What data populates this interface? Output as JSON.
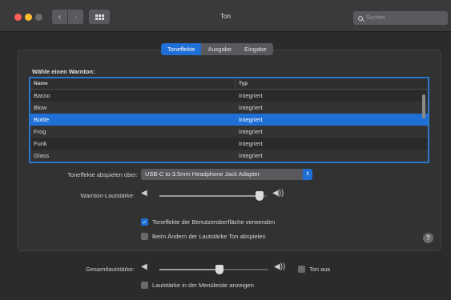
{
  "window": {
    "title": "Ton"
  },
  "toolbar": {
    "back": "‹",
    "forward": "›",
    "search_placeholder": "Suchen"
  },
  "tabs": [
    {
      "label": "Toneffekte",
      "active": true
    },
    {
      "label": "Ausgabe",
      "active": false
    },
    {
      "label": "Eingabe",
      "active": false
    }
  ],
  "alerts": {
    "heading": "Wähle einen Warnton:",
    "columns": [
      "Name",
      "Typ"
    ],
    "rows": [
      {
        "name": "Basso",
        "type": "Integriert"
      },
      {
        "name": "Blow",
        "type": "Integriert"
      },
      {
        "name": "Bottle",
        "type": "Integriert",
        "selected": true
      },
      {
        "name": "Frog",
        "type": "Integriert"
      },
      {
        "name": "Funk",
        "type": "Integriert"
      },
      {
        "name": "Glass",
        "type": "Integriert"
      }
    ]
  },
  "play_through": {
    "label": "Toneffekte abspielen über:",
    "value": "USB-C to 3.5mm Headphone Jack Adapter"
  },
  "alert_volume": {
    "label": "Warnton-Lautstärke:",
    "level": 0.93
  },
  "checkboxes": {
    "ui_effects": {
      "label": "Toneffekte der Benutzeroberfläche verwenden",
      "checked": true
    },
    "volume_feedback": {
      "label": "Beim Ändern der Lautstärke Ton abspielen",
      "checked": false
    }
  },
  "help": "?",
  "output_volume": {
    "label": "Gesamtlautstärke:",
    "level": 0.55,
    "mute_label": "Ton aus",
    "muted": false
  },
  "menubar_volume": {
    "label": "Lautstärke in der Menüleiste anzeigen",
    "checked": false
  },
  "colors": {
    "accent": "#1f6fd6",
    "window_bg": "#2b2b2c"
  }
}
